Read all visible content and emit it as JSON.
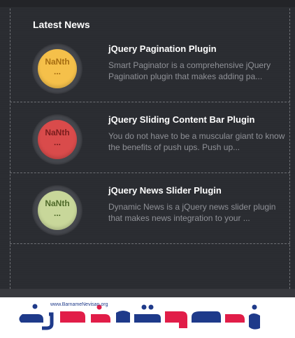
{
  "widget": {
    "heading": "Latest News"
  },
  "news": [
    {
      "title": "jQuery Pagination Plugin",
      "excerpt_line1": "Smart Paginator is a comprehensive jQuery",
      "excerpt_line2": "Pagination plugin that makes adding pa...",
      "thumb_line1": "NaNth",
      "thumb_line2": "...",
      "thumb_bg": "#f5c04a",
      "thumb_fg": "#a66d12"
    },
    {
      "title": "jQuery Sliding Content Bar Plugin",
      "excerpt_line1": "You do not have to be a muscular giant to know",
      "excerpt_line2": "the benefits of push ups. Push up...",
      "thumb_line1": "NaNth",
      "thumb_line2": "...",
      "thumb_bg": "#d94b4b",
      "thumb_fg": "#7a1d1d"
    },
    {
      "title": "jQuery News Slider Plugin",
      "excerpt_line1": "Dynamic News is a jQuery news slider plugin",
      "excerpt_line2": "that makes news integration to your ...",
      "thumb_line1": "NaNth",
      "thumb_line2": "...",
      "thumb_bg": "#c8d79a",
      "thumb_fg": "#4f6a2a"
    }
  ],
  "watermark": {
    "url": "www.BarnameNevisan.org"
  },
  "colors": {
    "background": "#2a2c31",
    "title": "#ffffff",
    "excerpt": "#8f9197",
    "divider": "#6e7075"
  }
}
